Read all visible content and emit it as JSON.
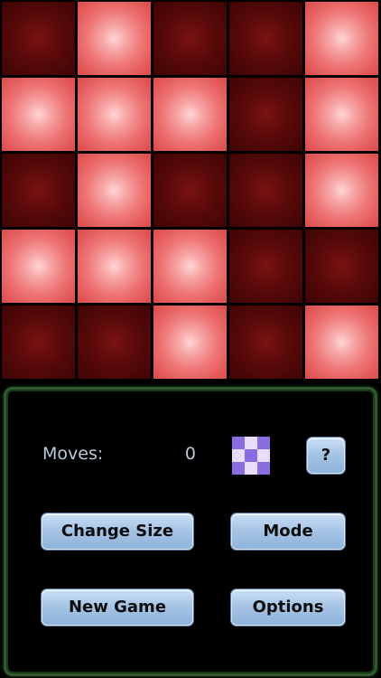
{
  "board": {
    "rows": 5,
    "cols": 5,
    "lit": [
      [
        0,
        1,
        0,
        0,
        1
      ],
      [
        1,
        1,
        1,
        0,
        1
      ],
      [
        0,
        1,
        0,
        0,
        1
      ],
      [
        1,
        1,
        1,
        0,
        0
      ],
      [
        0,
        0,
        1,
        0,
        1
      ]
    ],
    "lit_color": "#ee7474",
    "unlit_color": "#5a0a0a"
  },
  "status": {
    "moves_label": "Moves:",
    "moves_value": "0"
  },
  "mode_icon": {
    "name": "pattern-grid-icon",
    "pattern": [
      [
        1,
        0,
        1
      ],
      [
        0,
        1,
        0
      ],
      [
        1,
        0,
        1
      ]
    ],
    "colors": {
      "on": "#8a6ee0",
      "off": "#e6ddfa"
    }
  },
  "controls": {
    "help_label": "?",
    "change_size_label": "Change Size",
    "mode_label": "Mode",
    "new_game_label": "New Game",
    "options_label": "Options"
  },
  "panel": {
    "border_color": "#2f5a2c"
  }
}
